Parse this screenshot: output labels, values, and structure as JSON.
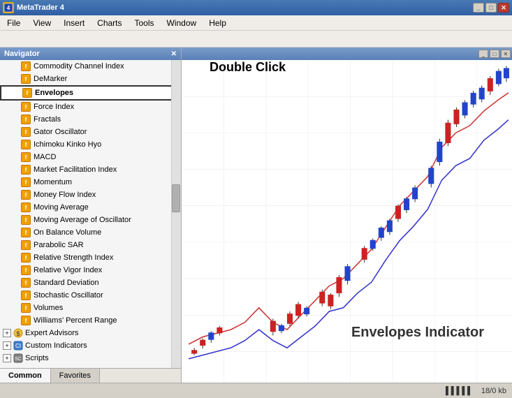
{
  "titleBar": {
    "title": "MetaTrader 4",
    "icon": "MT",
    "controls": [
      "_",
      "□",
      "✕"
    ]
  },
  "menuBar": {
    "items": [
      "File",
      "View",
      "Insert",
      "Charts",
      "Tools",
      "Window",
      "Help"
    ]
  },
  "navigator": {
    "title": "Navigator",
    "indicators": [
      "Commodity Channel Index",
      "DeMarker",
      "Envelopes",
      "Force Index",
      "Fractals",
      "Gator Oscillator",
      "Ichimoku Kinko Hyo",
      "MACD",
      "Market Facilitation Index",
      "Momentum",
      "Money Flow Index",
      "Moving Average",
      "Moving Average of Oscillator",
      "On Balance Volume",
      "Parabolic SAR",
      "Relative Strength Index",
      "Relative Vigor Index",
      "Standard Deviation",
      "Stochastic Oscillator",
      "Volumes",
      "Williams' Percent Range"
    ],
    "groups": [
      "Expert Advisors",
      "Custom Indicators",
      "Scripts"
    ],
    "tabs": [
      "Common",
      "Favorites"
    ]
  },
  "chart": {
    "doubleClickLabel": "Double Click",
    "envelopesLabel": "Envelopes Indicator"
  },
  "statusBar": {
    "indicator": "▐▐▐▐▐",
    "info": "18/0 kb"
  }
}
